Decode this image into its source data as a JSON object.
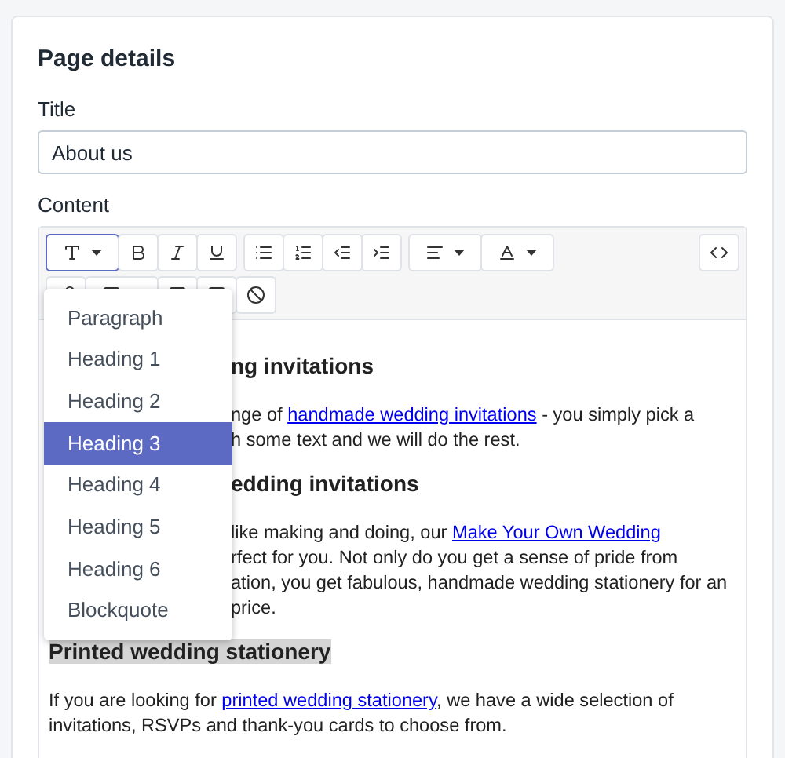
{
  "card": {
    "title": "Page details"
  },
  "title_field": {
    "label": "Title",
    "value": "About us"
  },
  "content": {
    "label": "Content",
    "format_menu": {
      "items": [
        {
          "label": "Paragraph",
          "selected": false
        },
        {
          "label": "Heading 1",
          "selected": false
        },
        {
          "label": "Heading 2",
          "selected": false
        },
        {
          "label": "Heading 3",
          "selected": true
        },
        {
          "label": "Heading 4",
          "selected": false
        },
        {
          "label": "Heading 5",
          "selected": false
        },
        {
          "label": "Heading 6",
          "selected": false
        },
        {
          "label": "Blockquote",
          "selected": false
        }
      ]
    },
    "blocks_beside_menu": [
      {
        "kind": "heading",
        "text": "ng invitations"
      },
      {
        "kind": "paragraph",
        "lines": [
          [
            {
              "kind": "text",
              "text": "nge of "
            },
            {
              "kind": "link",
              "text": "handmade wedding invitations"
            },
            {
              "kind": "text",
              "text": " - you simply pick a"
            }
          ],
          [
            {
              "kind": "text",
              "text": "h some text and we will do the rest."
            }
          ]
        ]
      },
      {
        "kind": "heading",
        "text": "edding invitations"
      },
      {
        "kind": "paragraph",
        "lines": [
          [
            {
              "kind": "text",
              "text": "like making and doing, our "
            },
            {
              "kind": "link",
              "text": "Make Your Own Wedding"
            }
          ],
          [
            {
              "kind": "text",
              "text": "rfect for you. Not only do you get a sense of pride from"
            }
          ],
          [
            {
              "kind": "text",
              "text": "ation, you get fabulous, handmade wedding stationery for an"
            }
          ],
          [
            {
              "kind": "text",
              "text": "price."
            }
          ]
        ]
      }
    ],
    "blocks": [
      {
        "kind": "heading",
        "selected": true,
        "text": "Printed wedding stationery"
      },
      {
        "kind": "paragraph",
        "lines": [
          [
            {
              "kind": "text",
              "text": "If you are looking for "
            },
            {
              "kind": "link",
              "text": "printed wedding stationery"
            },
            {
              "kind": "text",
              "text": ", we have a wide selection of"
            }
          ],
          [
            {
              "kind": "text",
              "text": "invitations, RSVPs and thank-you cards to choose from."
            }
          ]
        ]
      }
    ]
  }
}
